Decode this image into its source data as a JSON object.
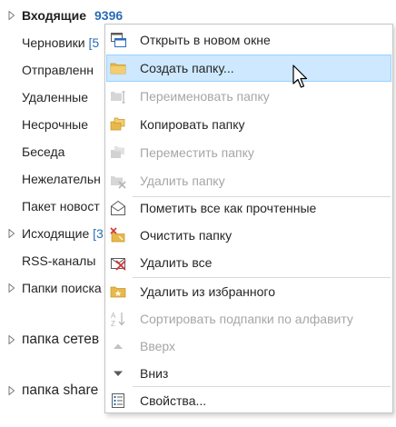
{
  "folders": {
    "inbox": {
      "label": "Входящие",
      "count": "9396"
    },
    "drafts": {
      "label": "Черновики",
      "count": "[5"
    },
    "sent": {
      "label": "Отправленн"
    },
    "deleted": {
      "label": "Удаленные"
    },
    "junk_urgent": {
      "label": "Несрочные"
    },
    "conversation": {
      "label": "Беседа"
    },
    "spam": {
      "label": "Нежелательн"
    },
    "news": {
      "label": "Пакет новост"
    },
    "outbox": {
      "label": "Исходящие",
      "count": "[3"
    },
    "rss": {
      "label": "RSS-каналы"
    },
    "search": {
      "label": "Папки поиска"
    },
    "network": {
      "label": "папка сетев"
    },
    "share": {
      "label": "папка share"
    }
  },
  "context_menu": {
    "open_new_window": "Открыть в новом окне",
    "create_folder": "Создать папку...",
    "rename_folder": "Переименовать папку",
    "copy_folder": "Копировать папку",
    "move_folder": "Переместить папку",
    "delete_folder": "Удалить папку",
    "mark_all_read": "Пометить все как прочтенные",
    "clean_folder": "Очистить папку",
    "delete_all": "Удалить все",
    "remove_favorites": "Удалить из избранного",
    "sort_subfolders": "Сортировать подпапки по алфавиту",
    "move_up": "Вверх",
    "move_down": "Вниз",
    "properties": "Свойства..."
  },
  "colors": {
    "accent_count": "#2b6cb8",
    "hover_bg": "#cde8ff",
    "hover_border": "#99d1ff",
    "disabled_text": "#a6a6a6"
  }
}
